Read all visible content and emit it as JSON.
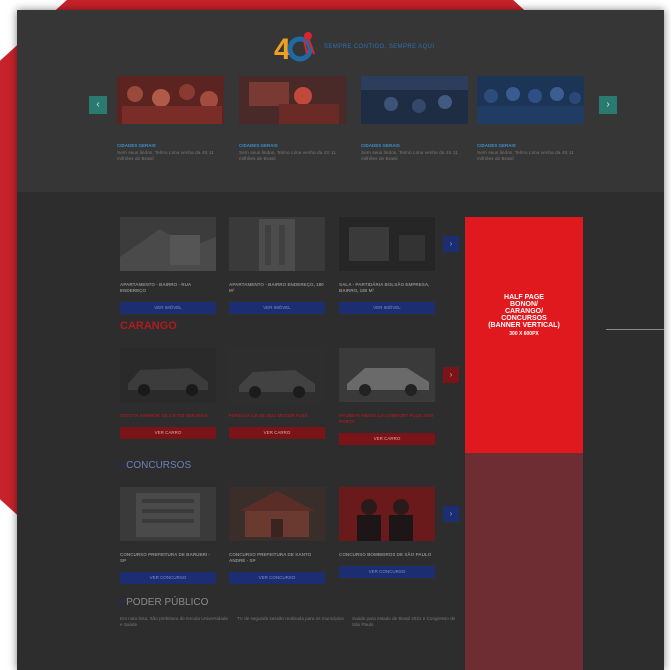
{
  "header": {
    "logo_text": "40",
    "tagline": "SEMPRE CONTIGO, SEMPRE AQUI"
  },
  "colors": {
    "backdrop_red": "#c8222a",
    "teal_arrow": "#2a7a72",
    "navy_button": "#1c2d72",
    "carango_red": "#b01a20",
    "banner_red": "#e0191f"
  },
  "top_carousel": {
    "prev_icon": "‹",
    "next_icon": "›",
    "cards": [
      {
        "category": "CIDADES GERAIS",
        "text": "Sem seus lindos, Telmo Lima venha da 4S 11 milhões de Brasil"
      },
      {
        "category": "CIDADES GERAIS",
        "text": "Sem seus lindos, Telmo Lima venha da 4S 11 milhões de Brasil"
      },
      {
        "category": "CIDADES GERAIS",
        "text": "Sem seus lindos, Telmo Lima venha da 4S 11 milhões de Brasil"
      },
      {
        "category": "CIDADES GERAIS",
        "text": "Sem seus lindos, Telmo Lima venha da 4S 11 milhões de Brasil"
      }
    ]
  },
  "imoveis": {
    "next_icon": "›",
    "cards": [
      {
        "title": "APARTAMENTO - BAIRRO - RUA ENDEREÇO",
        "button": "VER IMÓVEL"
      },
      {
        "title": "APARTAMENTO - BAIRRO ENDEREÇO, 180 M²",
        "button": "VER IMÓVEL"
      },
      {
        "title": "SALA - PARTIDÁRIA BOLSÃO EMPRESA, BAIRRO, 180 M²",
        "button": "VER IMÓVEL"
      }
    ]
  },
  "carango": {
    "title": "CARANGO",
    "next_icon": "›",
    "cards": [
      {
        "title": "TOYOTA AMAROK SE 2.0 TDI VER MAIS",
        "button": "VER CARRO"
      },
      {
        "title": "FORD KA 1.0 SE 2021 MOTOR FLEX",
        "button": "VER CARRO"
      },
      {
        "title": "HYUNDAI HB20S 1.0 COMFORT PLUS 2019 PORTA",
        "button": "VER CARRO"
      }
    ]
  },
  "concursos": {
    "title": "CONCURSOS",
    "next_icon": "›",
    "cards": [
      {
        "title": "CONCURSO PREFEITURA DE BARUERI - SP",
        "button": "VER CONCURSO"
      },
      {
        "title": "CONCURSO PREFEITURA DE SANTO ANDRÉ - SP",
        "button": "VER CONCURSO"
      },
      {
        "title": "CONCURSO BOMBEIROS DE SÃO PAULO",
        "button": "VER CONCURSO"
      }
    ]
  },
  "banner": {
    "lines": [
      "HALF PAGE",
      "BONON/",
      "CARANGO/",
      "CONCURSOS",
      "(BANNER VERTICAL)"
    ],
    "size": "300 X 600PX"
  },
  "poder_publico": {
    "title": "PODER PÚBLICO",
    "items": [
      "Em nota feita, São prefeitura de Escola Universidade e Saúde",
      "TV de segunda sessão realizada para os municípios",
      "Saúde para estado de Brasil 2021 e Congresso de São Paulo"
    ]
  }
}
